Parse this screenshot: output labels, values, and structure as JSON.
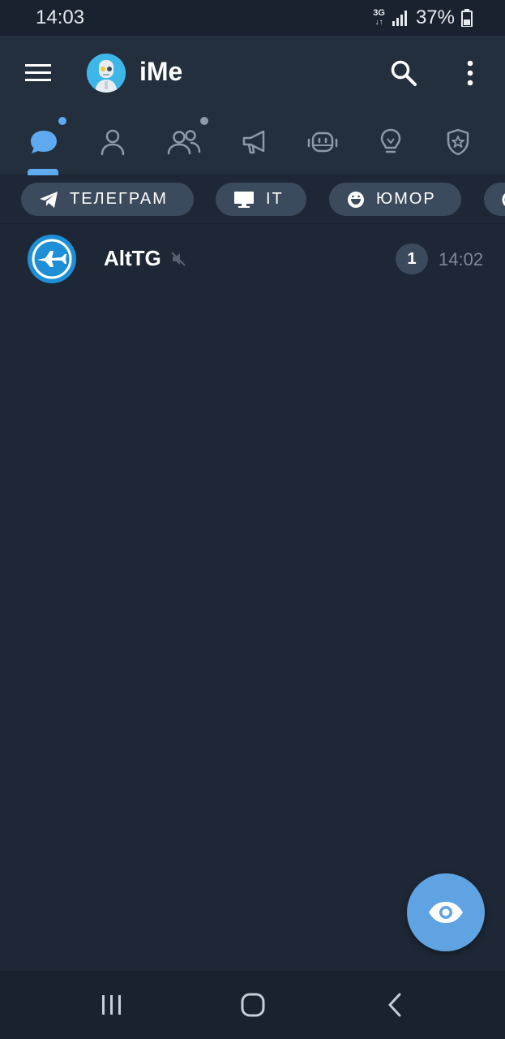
{
  "status_bar": {
    "time": "14:03",
    "network_type": "3G",
    "network_arrows": "↓↑",
    "battery_percent": "37%"
  },
  "header": {
    "title": "iMe",
    "menu_icon": "hamburger-menu-icon",
    "search_icon": "search-icon",
    "more_icon": "more-vert-icon"
  },
  "tabs": [
    {
      "name": "all-chats",
      "icon": "chat-bubble-icon",
      "selected": true,
      "dot": true
    },
    {
      "name": "private",
      "icon": "user-icon",
      "selected": false,
      "dot": false
    },
    {
      "name": "groups",
      "icon": "group-icon",
      "selected": false,
      "dot": true
    },
    {
      "name": "channels",
      "icon": "megaphone-icon",
      "selected": false,
      "dot": false
    },
    {
      "name": "bots",
      "icon": "robot-icon",
      "selected": false,
      "dot": false
    },
    {
      "name": "ideas",
      "icon": "lightbulb-icon",
      "selected": false,
      "dot": false
    },
    {
      "name": "admin",
      "icon": "shield-star-icon",
      "selected": false,
      "dot": false
    }
  ],
  "chips": [
    {
      "label": "ТЕЛЕГРАМ",
      "icon": "telegram-plane-icon"
    },
    {
      "label": "IT",
      "icon": "monitor-icon"
    },
    {
      "label": "ЮМОР",
      "icon": "smile-icon"
    }
  ],
  "chats": [
    {
      "name": "AltTG",
      "muted": true,
      "unread": "1",
      "time": "14:02",
      "avatar_icon": "jet-plane-icon"
    }
  ],
  "fab": {
    "icon": "eye-icon"
  },
  "nav": {
    "recents_icon": "recents-icon",
    "home_icon": "home-icon",
    "back_icon": "back-icon"
  },
  "colors": {
    "background": "#1e2735",
    "header": "#242f3e",
    "accent": "#5fa9f0",
    "chip": "#3b4a5c",
    "fab": "#5fa3e3",
    "secondary_text": "#7d8a99"
  }
}
